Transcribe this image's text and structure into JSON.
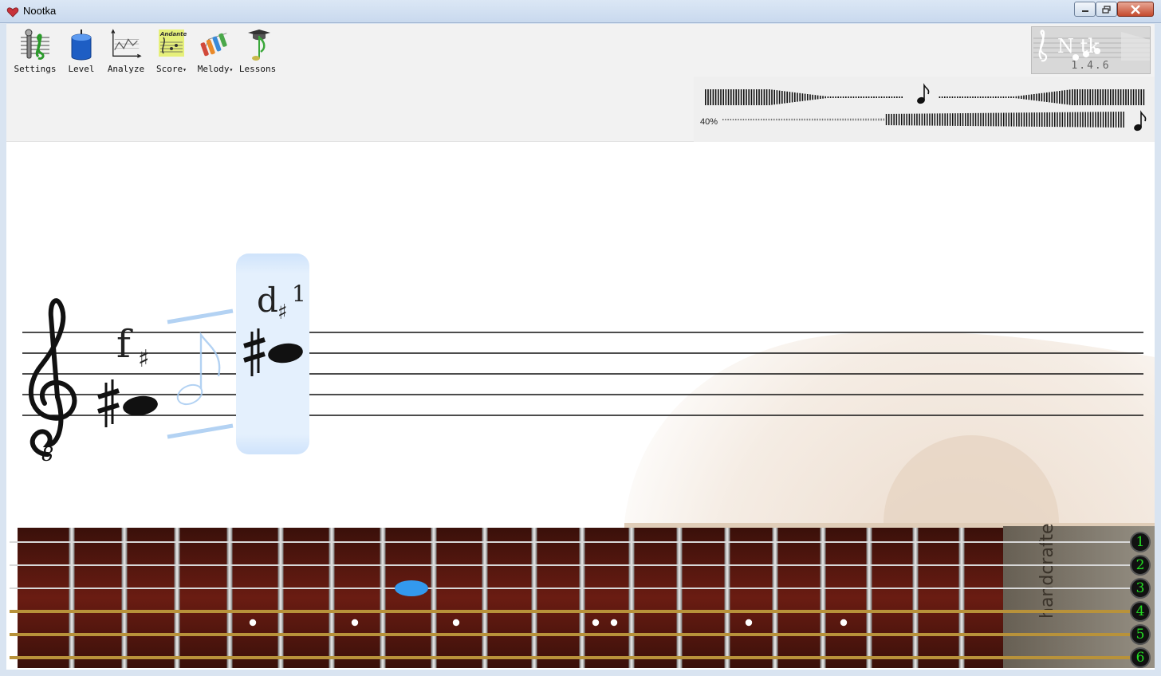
{
  "window": {
    "title": "Nootka"
  },
  "toolbar": {
    "items": [
      {
        "label": "Settings",
        "icon": "settings-icon"
      },
      {
        "label": "Level",
        "icon": "level-icon"
      },
      {
        "label": "Analyze",
        "icon": "analyze-icon"
      },
      {
        "label": "Score",
        "icon": "score-icon",
        "has_menu": true
      },
      {
        "label": "Melody",
        "icon": "melody-icon",
        "has_menu": true
      },
      {
        "label": "Lessons",
        "icon": "lessons-icon"
      }
    ],
    "score_icon_text": "Andante"
  },
  "logo": {
    "text": "N   tk",
    "version": "1.4.6"
  },
  "meters": {
    "volume_percent_label": "40%",
    "volume_level": 0.4
  },
  "score": {
    "clef": "treble-8vb",
    "clef_octave_mark": "8",
    "notes": [
      {
        "name": "f",
        "accidental": "♯",
        "octave": ""
      },
      {
        "name": "d",
        "accidental": "♯",
        "octave": "1",
        "highlighted": true
      }
    ]
  },
  "fretboard": {
    "string_numbers": [
      "1",
      "2",
      "3",
      "4",
      "5",
      "6"
    ],
    "label_text": "handcrafted",
    "selected_position": {
      "string": 3,
      "fret": 8
    },
    "colors": {
      "selected": "#3399ee",
      "string_numbers": "#22dd22"
    }
  }
}
